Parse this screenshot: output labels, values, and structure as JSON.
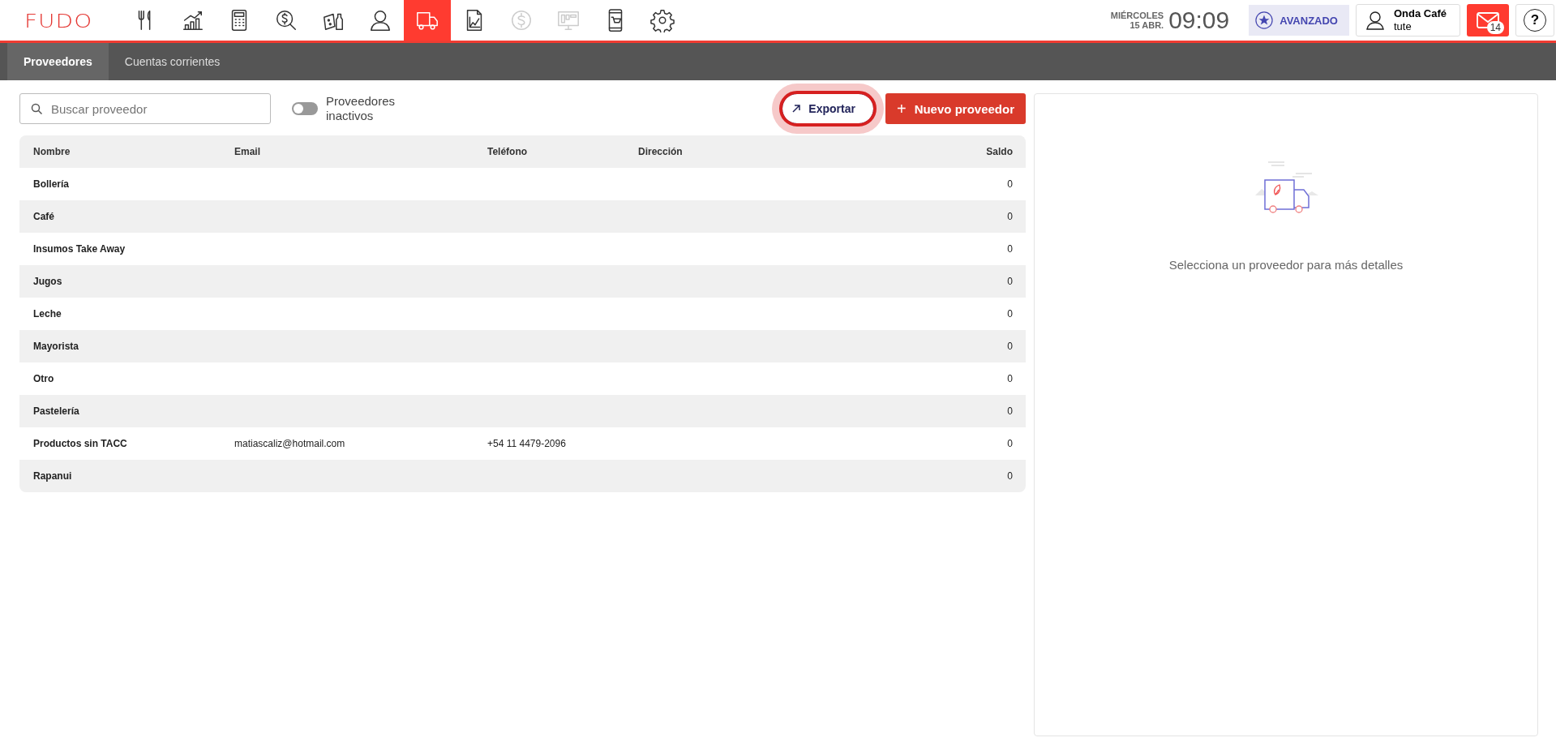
{
  "logo": "FUDO",
  "nav": [
    {
      "selected": false,
      "disabled": false
    },
    {
      "selected": false,
      "disabled": false
    },
    {
      "selected": false,
      "disabled": false
    },
    {
      "selected": false,
      "disabled": false
    },
    {
      "selected": false,
      "disabled": false
    },
    {
      "selected": false,
      "disabled": false
    },
    {
      "selected": true,
      "disabled": false
    },
    {
      "selected": false,
      "disabled": false
    },
    {
      "selected": false,
      "disabled": true
    },
    {
      "selected": false,
      "disabled": true
    },
    {
      "selected": false,
      "disabled": false
    },
    {
      "selected": false,
      "disabled": false
    }
  ],
  "clock": {
    "weekday": "MIÉRCOLES",
    "date": "15 ABR.",
    "time": "09:09"
  },
  "plan": "AVANZADO",
  "account": {
    "name": "Onda Café",
    "user": "tute"
  },
  "messages": {
    "count": "14"
  },
  "help": "?",
  "tabs": [
    {
      "label": "Proveedores",
      "selected": true
    },
    {
      "label": "Cuentas corrientes",
      "selected": false
    }
  ],
  "search": {
    "placeholder": "Buscar proveedor"
  },
  "inactive_toggle": {
    "label": "Proveedores inactivos",
    "on": false
  },
  "export_button": {
    "label": "Exportar",
    "focused": true
  },
  "new_button": {
    "label": "+",
    "text": "Nuevo proveedor"
  },
  "table": {
    "columns": [
      "Nombre",
      "Email",
      "Teléfono",
      "Dirección",
      "Saldo"
    ],
    "rows": [
      [
        "Bollería",
        "",
        "",
        "",
        "0"
      ],
      [
        "Café",
        "",
        "",
        "",
        "0"
      ],
      [
        "Insumos Take Away",
        "",
        "",
        "",
        "0"
      ],
      [
        "Jugos",
        "",
        "",
        "",
        "0"
      ],
      [
        "Leche",
        "",
        "",
        "",
        "0"
      ],
      [
        "Mayorista",
        "",
        "",
        "",
        "0"
      ],
      [
        "Otro",
        "",
        "",
        "",
        "0"
      ],
      [
        "Pastelería",
        "",
        "",
        "",
        "0"
      ],
      [
        "Productos sin TACC",
        "matiascaliz@hotmail.com",
        "+54 11 4479-2096",
        "",
        "0"
      ],
      [
        "Rapanui",
        "",
        "",
        "",
        "0"
      ]
    ]
  },
  "detail": {
    "empty_message": "Selecciona un proveedor para más detalles"
  }
}
